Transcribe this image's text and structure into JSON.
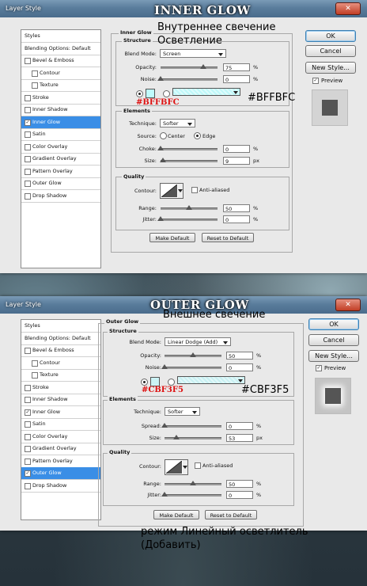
{
  "inner": {
    "window_title": "Layer Style",
    "heading": "INNER GLOW",
    "close_label": "✕",
    "note_line1": "Внутреннее свечение",
    "note_line2": "Осветление",
    "hex_red": "#BFFBFC",
    "hex_black": "#BFFBFC",
    "left_items": [
      {
        "label": "Styles",
        "checked": false,
        "type": "header"
      },
      {
        "label": "Blending Options: Default",
        "checked": false,
        "type": "header"
      },
      {
        "label": "Bevel & Emboss",
        "checked": false,
        "type": "item"
      },
      {
        "label": "Contour",
        "checked": false,
        "type": "sub"
      },
      {
        "label": "Texture",
        "checked": false,
        "type": "sub"
      },
      {
        "label": "Stroke",
        "checked": false,
        "type": "item"
      },
      {
        "label": "Inner Shadow",
        "checked": false,
        "type": "item"
      },
      {
        "label": "Inner Glow",
        "checked": true,
        "type": "item",
        "selected": true
      },
      {
        "label": "Satin",
        "checked": false,
        "type": "item"
      },
      {
        "label": "Color Overlay",
        "checked": false,
        "type": "item"
      },
      {
        "label": "Gradient Overlay",
        "checked": false,
        "type": "item"
      },
      {
        "label": "Pattern Overlay",
        "checked": false,
        "type": "item"
      },
      {
        "label": "Outer Glow",
        "checked": false,
        "type": "item"
      },
      {
        "label": "Drop Shadow",
        "checked": false,
        "type": "item"
      }
    ],
    "group_title": "Inner Glow",
    "structure_label": "Structure",
    "blend_mode_label": "Blend Mode:",
    "blend_mode_value": "Screen",
    "opacity_label": "Opacity:",
    "opacity_value": "75",
    "opacity_level": 0.75,
    "noise_label": "Noise:",
    "noise_value": "0",
    "noise_level": 0,
    "percent": "%",
    "px": "px",
    "color_value": "#BFFBFC",
    "elements_label": "Elements",
    "technique_label": "Technique:",
    "technique_value": "Softer",
    "source_label": "Source:",
    "source_center": "Center",
    "source_edge": "Edge",
    "choke_label": "Choke:",
    "choke_value": "0",
    "choke_level": 0,
    "size_label": "Size:",
    "size_value": "9",
    "size_level": 0.036,
    "quality_label": "Quality",
    "contour_label": "Contour:",
    "antialiased_label": "Anti-aliased",
    "range_label": "Range:",
    "range_value": "50",
    "range_level": 0.5,
    "jitter_label": "Jitter:",
    "jitter_value": "0",
    "jitter_level": 0,
    "make_default": "Make Default",
    "reset_default": "Reset to Default",
    "ok_label": "OK",
    "cancel_label": "Cancel",
    "new_style_label": "New Style...",
    "preview_label": "Preview"
  },
  "outer": {
    "window_title": "Layer Style",
    "heading": "OUTER GLOW",
    "close_label": "✕",
    "note_line1": "Внешнее свечение",
    "hex_red": "#CBF3F5",
    "hex_black": "#CBF3F5",
    "bottom_note_line1": "режим Линейный осветлитель",
    "bottom_note_line2": "(Добавить)",
    "left_items": [
      {
        "label": "Styles",
        "checked": false,
        "type": "header"
      },
      {
        "label": "Blending Options: Default",
        "checked": false,
        "type": "header"
      },
      {
        "label": "Bevel & Emboss",
        "checked": false,
        "type": "item"
      },
      {
        "label": "Contour",
        "checked": false,
        "type": "sub"
      },
      {
        "label": "Texture",
        "checked": false,
        "type": "sub"
      },
      {
        "label": "Stroke",
        "checked": false,
        "type": "item"
      },
      {
        "label": "Inner Shadow",
        "checked": false,
        "type": "item"
      },
      {
        "label": "Inner Glow",
        "checked": true,
        "type": "item"
      },
      {
        "label": "Satin",
        "checked": false,
        "type": "item"
      },
      {
        "label": "Color Overlay",
        "checked": false,
        "type": "item"
      },
      {
        "label": "Gradient Overlay",
        "checked": false,
        "type": "item"
      },
      {
        "label": "Pattern Overlay",
        "checked": false,
        "type": "item"
      },
      {
        "label": "Outer Glow",
        "checked": true,
        "type": "item",
        "selected": true
      },
      {
        "label": "Drop Shadow",
        "checked": false,
        "type": "item"
      }
    ],
    "group_title": "Outer Glow",
    "structure_label": "Structure",
    "blend_mode_label": "Blend Mode:",
    "blend_mode_value": "Linear Dodge (Add)",
    "opacity_label": "Opacity:",
    "opacity_value": "50",
    "opacity_level": 0.5,
    "noise_label": "Noise:",
    "noise_value": "0",
    "noise_level": 0,
    "percent": "%",
    "px": "px",
    "color_value": "#CBF3F5",
    "elements_label": "Elements",
    "technique_label": "Technique:",
    "technique_value": "Softer",
    "spread_label": "Spread:",
    "spread_value": "0",
    "spread_level": 0,
    "size_label": "Size:",
    "size_value": "53",
    "size_level": 0.212,
    "quality_label": "Quality",
    "contour_label": "Contour:",
    "antialiased_label": "Anti-aliased",
    "range_label": "Range:",
    "range_value": "50",
    "range_level": 0.5,
    "jitter_label": "Jitter:",
    "jitter_value": "0",
    "jitter_level": 0,
    "make_default": "Make Default",
    "reset_default": "Reset to Default",
    "ok_label": "OK",
    "cancel_label": "Cancel",
    "new_style_label": "New Style...",
    "preview_label": "Preview"
  }
}
